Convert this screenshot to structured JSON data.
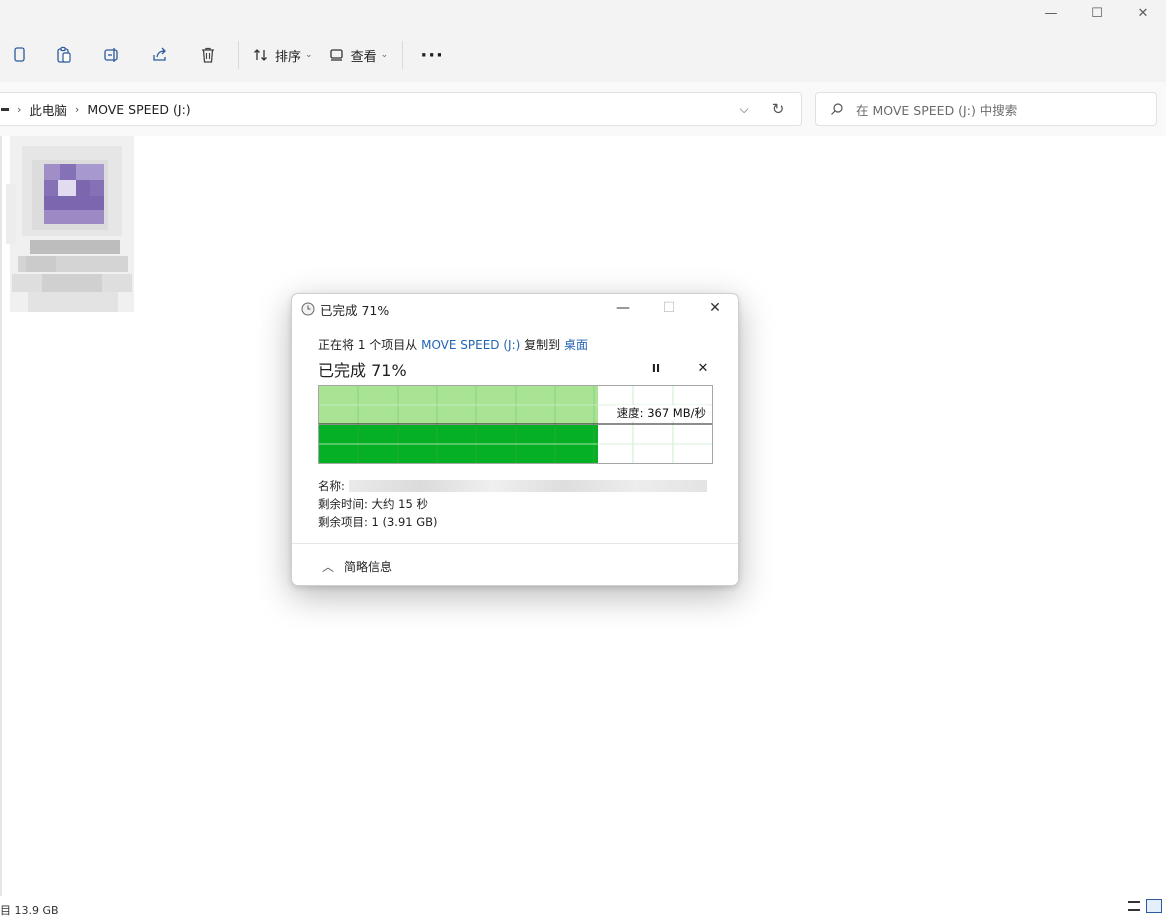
{
  "window": {
    "controls": {
      "minimize": "—",
      "maximize": "☐",
      "close": "✕"
    }
  },
  "toolbar": {
    "sort_label": "排序",
    "view_label": "查看",
    "more_label": "···"
  },
  "address": {
    "crumbs": [
      "此电脑",
      "MOVE SPEED (J:)"
    ],
    "dropdown": "⌵",
    "refresh": "↻"
  },
  "search": {
    "placeholder": "在 MOVE SPEED (J:) 中搜索"
  },
  "status": {
    "text": "目 13.9 GB"
  },
  "dialog": {
    "title": "已完成 71%",
    "line_prefix": "正在将 1 个项目从",
    "source": "MOVE SPEED (J:)",
    "line_middle": "复制到",
    "destination": "桌面",
    "heading": "已完成 71%",
    "pause": "II",
    "cancel": "✕",
    "speed": "速度: 367 MB/秒",
    "progress": 0.71,
    "name_label": "名称:",
    "time_label": "剩余时间: 大约 15 秒",
    "items_label": "剩余项目: 1 (3.91 GB)",
    "less_info": "简略信息",
    "colors": {
      "throughput_fill": "#a8e494",
      "progress_fill": "#06b025",
      "grid_line": "#cdeecd",
      "link": "#2464b4"
    }
  }
}
